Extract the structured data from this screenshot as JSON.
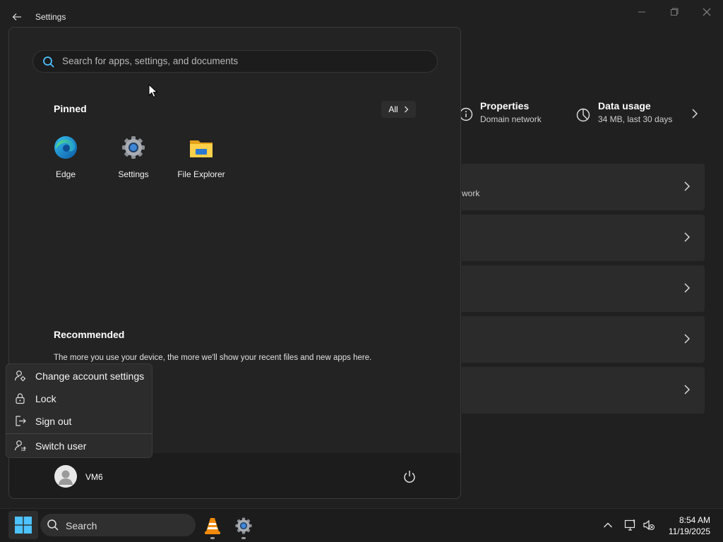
{
  "window": {
    "title": "Settings",
    "controls": [
      "minimize",
      "restore",
      "close"
    ]
  },
  "network_props": {
    "properties": {
      "title": "Properties",
      "subtitle": "Domain network",
      "icon": "info-icon"
    },
    "data_usage": {
      "title": "Data usage",
      "subtitle": "34 MB, last 30 days",
      "icon": "pie-chart-icon"
    }
  },
  "settings_cards": [
    {
      "subtitle": "work"
    },
    {
      "subtitle": ""
    },
    {
      "subtitle": ""
    },
    {
      "subtitle": ""
    },
    {
      "subtitle": ""
    }
  ],
  "start_menu": {
    "search_placeholder": "Search for apps, settings, and documents",
    "pinned_heading": "Pinned",
    "all_button": "All",
    "pinned_apps": [
      {
        "label": "Edge",
        "icon": "edge-icon"
      },
      {
        "label": "Settings",
        "icon": "settings-gear-icon"
      },
      {
        "label": "File Explorer",
        "icon": "folder-icon"
      }
    ],
    "recommended_heading": "Recommended",
    "recommended_text": "The more you use your device, the more we'll show your recent files and new apps here.",
    "user_name": "VM6"
  },
  "account_menu": {
    "items": [
      {
        "label": "Change account settings",
        "icon": "user-settings-icon"
      },
      {
        "label": "Lock",
        "icon": "lock-icon"
      },
      {
        "label": "Sign out",
        "icon": "sign-out-icon"
      },
      {
        "label": "Switch user",
        "icon": "switch-user-icon"
      }
    ]
  },
  "taskbar": {
    "search_label": "Search",
    "time": "8:54 AM",
    "date": "11/19/2025"
  },
  "colors": {
    "accent": "#4cc2ff",
    "background": "#202020",
    "start_bg": "#232323",
    "card_bg": "#2b2b2b"
  }
}
